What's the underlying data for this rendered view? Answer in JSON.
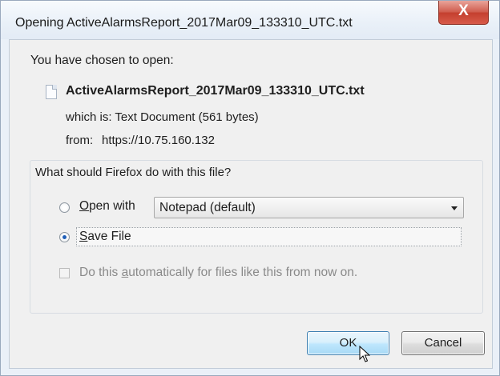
{
  "window": {
    "title": "Opening ActiveAlarmsReport_2017Mar09_133310_UTC.txt",
    "close_glyph": "X"
  },
  "content": {
    "intro": "You have chosen to open:",
    "file_icon": "text-document-icon",
    "filename": "ActiveAlarmsReport_2017Mar09_133310_UTC.txt",
    "which_is": "which is: Text Document (561 bytes)",
    "from_label": "from:",
    "from_value": "https://10.75.160.132"
  },
  "group": {
    "legend": "What should Firefox do with this file?",
    "open_with": {
      "prefix": "",
      "accel": "O",
      "rest": "pen with",
      "selected": false
    },
    "app_select": {
      "value": "Notepad (default)"
    },
    "save_file": {
      "accel": "S",
      "rest": "ave File",
      "selected": true
    },
    "auto": {
      "before": "Do this ",
      "accel": "a",
      "after": "utomatically for files like this from now on.",
      "checked": false,
      "enabled": false
    }
  },
  "buttons": {
    "ok": "OK",
    "cancel": "Cancel"
  },
  "colors": {
    "close_button": "#c43f2e",
    "ok_border": "#3c7fb1",
    "radio_dot": "#1f5fb8"
  }
}
